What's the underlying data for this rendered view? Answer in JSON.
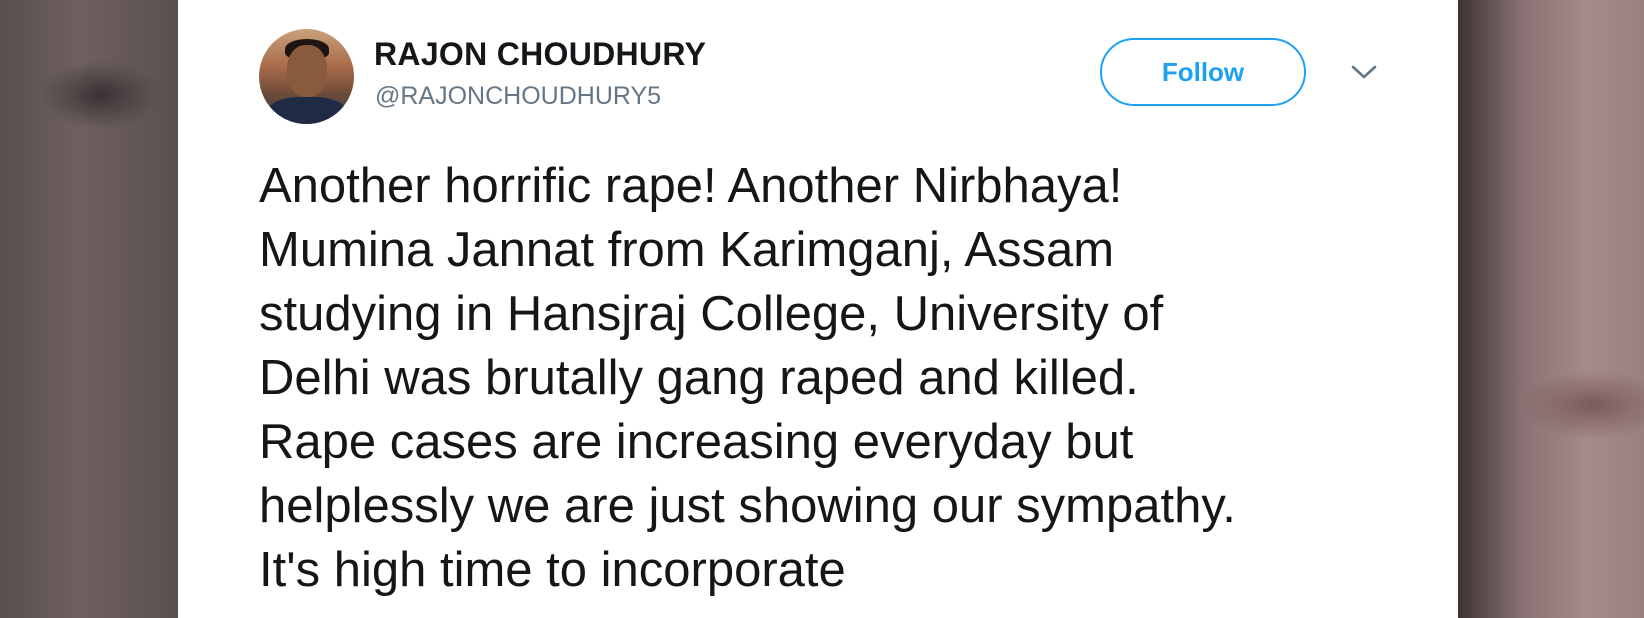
{
  "tweet": {
    "author_name": "RAJON CHOUDHURY",
    "author_handle": "@RAJONCHOUDHURY5",
    "follow_label": "Follow",
    "lines": [
      "Another horrific rape! Another Nirbhaya!",
      "Mumina Jannat from Karimganj, Assam",
      "studying in Hansjraj College, University of",
      "Delhi was brutally gang raped and killed.",
      "Rape cases are increasing everyday but",
      "helplessly we are just showing our sympathy.",
      "It's high time to incorporate"
    ]
  },
  "icons": {
    "avatar": "user-avatar-photo",
    "menu": "chevron-down-icon"
  },
  "colors": {
    "accent": "#1da1f2",
    "text_primary": "#14171a",
    "text_secondary": "#657786",
    "card_bg": "#ffffff"
  }
}
